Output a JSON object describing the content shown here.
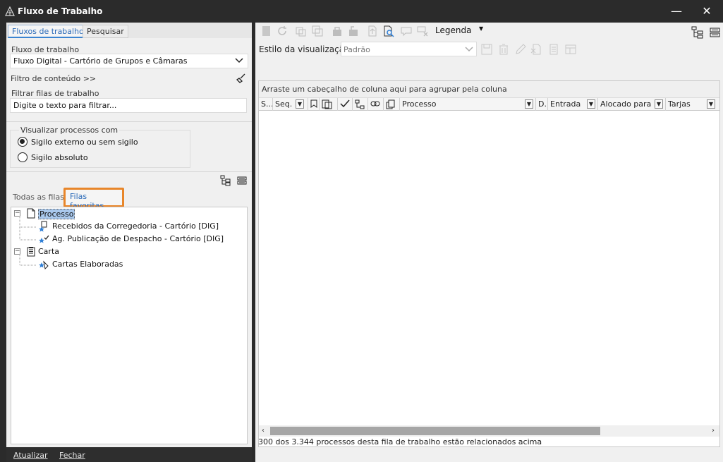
{
  "window": {
    "title": "Fluxo de Trabalho",
    "minimize": "—",
    "close": "✕"
  },
  "left": {
    "tabs": [
      {
        "label": "Fluxos de trabalho",
        "active": true
      },
      {
        "label": "Pesquisar",
        "active": false
      }
    ],
    "workflow_label": "Fluxo de trabalho",
    "workflow_value": "Fluxo Digital - Cartório de Grupos e Câmaras",
    "content_filter_label": "Filtro de conteúdo >>",
    "queue_filter_label": "Filtrar filas de trabalho",
    "queue_filter_placeholder": "Digite o texto para filtrar...",
    "view_group_label": "Visualizar processos com",
    "radio_options": [
      {
        "label": "Sigilo externo ou sem sigilo",
        "selected": true
      },
      {
        "label": "Sigilo absoluto",
        "selected": false
      }
    ],
    "queue_tabs": [
      {
        "label": "Todas as filas",
        "active": false
      },
      {
        "label": "Filas favoritas",
        "active": true
      }
    ],
    "tree": [
      {
        "label": "Processo",
        "level": 0,
        "expander": "−",
        "icon": "document-icon",
        "selected": true
      },
      {
        "label": "Recebidos da Corregedoria - Cartório [DIG]",
        "level": 1,
        "icon": "queue-star-icon"
      },
      {
        "label": "Ag. Publicação de Despacho - Cartório [DIG]",
        "level": 1,
        "icon": "queue-star-check-icon"
      },
      {
        "label": "Carta",
        "level": 0,
        "expander": "−",
        "icon": "letter-icon"
      },
      {
        "label": "Cartas Elaboradas",
        "level": 1,
        "icon": "queue-star-icon"
      }
    ],
    "buttons": {
      "refresh": "Atualizar",
      "close": "Fechar"
    }
  },
  "right": {
    "toolbar": {
      "legend_label": "Legenda",
      "view_style_label": "Estilo da visualização",
      "view_style_value": "Padrão"
    },
    "grid": {
      "group_hint": "Arraste um cabeçalho de coluna aqui para agrupar pela coluna",
      "columns": [
        "S...",
        "Seq.",
        "",
        "",
        "",
        "",
        "",
        "",
        "Processo",
        "D.",
        "Entrada",
        "Alocado para ...",
        "Tarjas"
      ]
    },
    "status": "300 dos 3.344 processos desta fila de trabalho estão relacionados acima"
  },
  "colors": {
    "titlebar": "#2b2b2b",
    "panel": "#f0f0f0",
    "accent_tab": "#3b84d1",
    "highlight_box": "#e8862a",
    "selection": "#a9c8ec"
  }
}
